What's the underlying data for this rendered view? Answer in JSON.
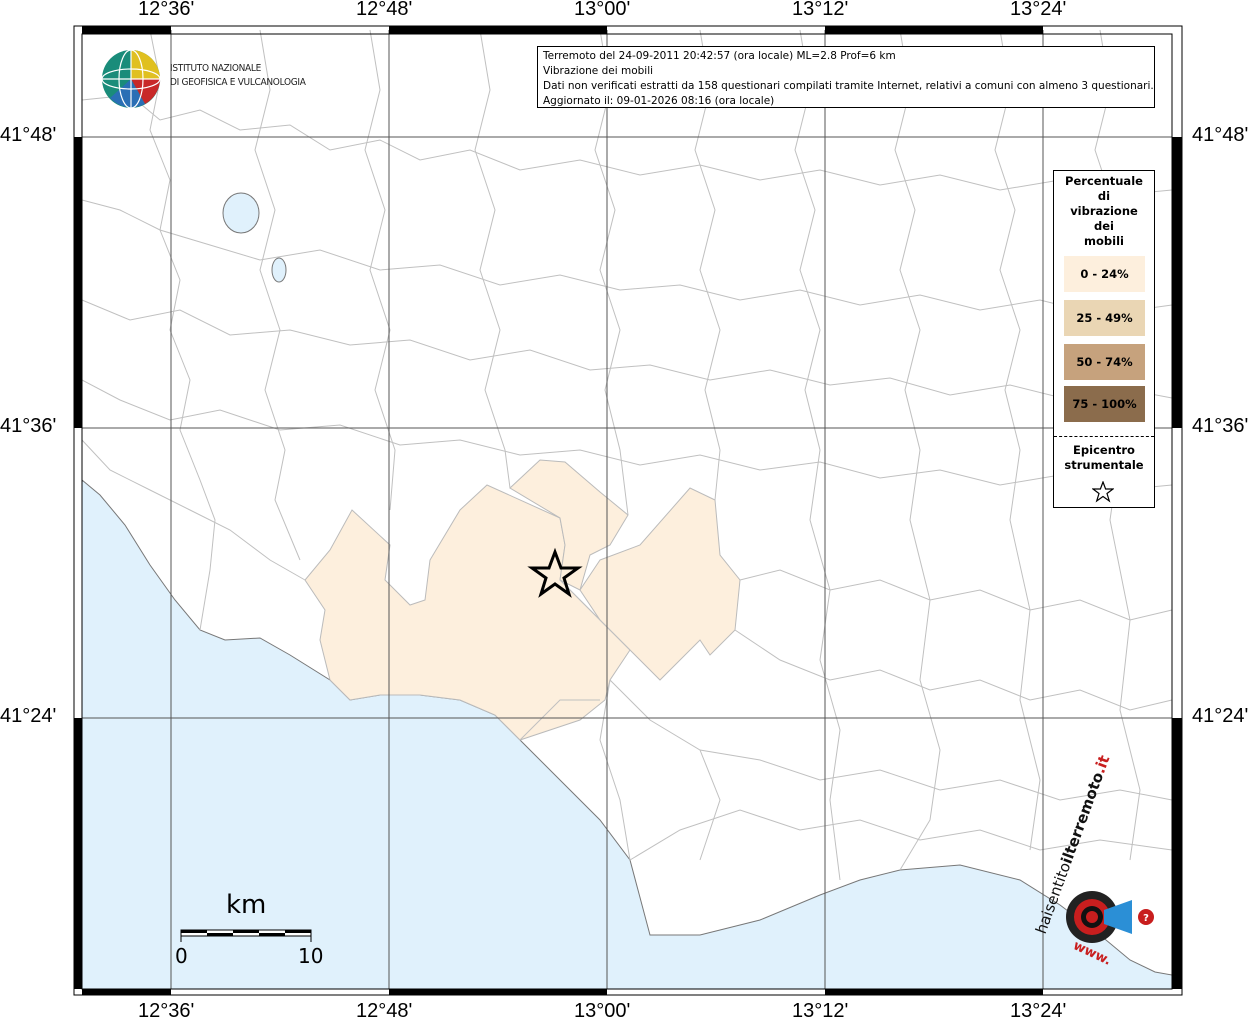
{
  "axis": {
    "lon_labels": [
      "12°36'",
      "12°48'",
      "13°00'",
      "13°12'",
      "13°24'"
    ],
    "lat_labels": [
      "41°48'",
      "41°36'",
      "41°24'"
    ]
  },
  "info": {
    "line1": "Terremoto del 24-09-2011 20:42:57 (ora locale) ML=2.8 Prof=6 km",
    "line2": "Vibrazione dei mobili",
    "line3": "Dati non verificati estratti da 158 questionari compilati tramite Internet, relativi a comuni con almeno 3 questionari.",
    "line4": "Aggiornato il: 09-01-2026 08:16 (ora locale)"
  },
  "logo": {
    "line1": "ISTITUTO NAZIONALE",
    "line2": "DI GEOFISICA E VULCANOLOGIA"
  },
  "legend": {
    "title_lines": [
      "Percentuale",
      "di",
      "vibrazione",
      "dei",
      "mobili"
    ],
    "items": [
      {
        "label": "0 - 24%",
        "color": "#fdefdd"
      },
      {
        "label": "25 - 49%",
        "color": "#ead6b4"
      },
      {
        "label": "50 - 74%",
        "color": "#c6a27d"
      },
      {
        "label": "75 - 100%",
        "color": "#8b6c4c"
      }
    ],
    "epicenter_line1": "Epicentro",
    "epicenter_line2": "strumentale"
  },
  "scale": {
    "unit": "km",
    "min": "0",
    "max": "10"
  },
  "watermark": {
    "text_a": "haisentito",
    "text_b": "ilterremoto",
    "text_c": ".it",
    "text_d": "www."
  },
  "colors": {
    "sea": "#e0f1fc",
    "affected": "#fdefdd",
    "border": "#b8b8b8"
  }
}
